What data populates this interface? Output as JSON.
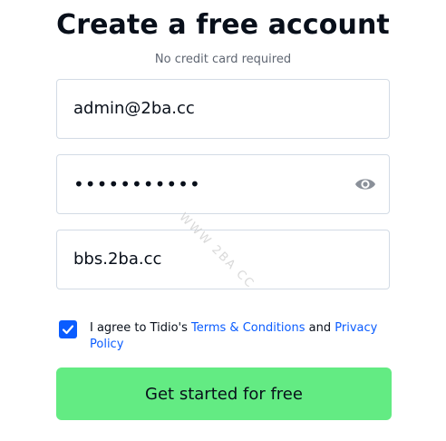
{
  "header": {
    "title": "Create a free account",
    "subtitle": "No credit card required"
  },
  "form": {
    "email_value": "admin@2ba.cc",
    "password_value": "•••••••••••",
    "website_value": "bbs.2ba.cc",
    "password_icon": "eye-icon"
  },
  "watermark": "WWW 2BA CC",
  "agreement": {
    "checked": true,
    "prefix": "I agree to Tidio's ",
    "terms_link": "Terms & Conditions",
    "middle": " and ",
    "privacy_link": "Privacy Policy"
  },
  "cta": {
    "label": "Get started for free"
  },
  "colors": {
    "accent": "#0a5cff",
    "button_bg": "#63eb83",
    "text": "#080f1a",
    "muted": "#5f6672",
    "border": "#d3dbe5"
  }
}
